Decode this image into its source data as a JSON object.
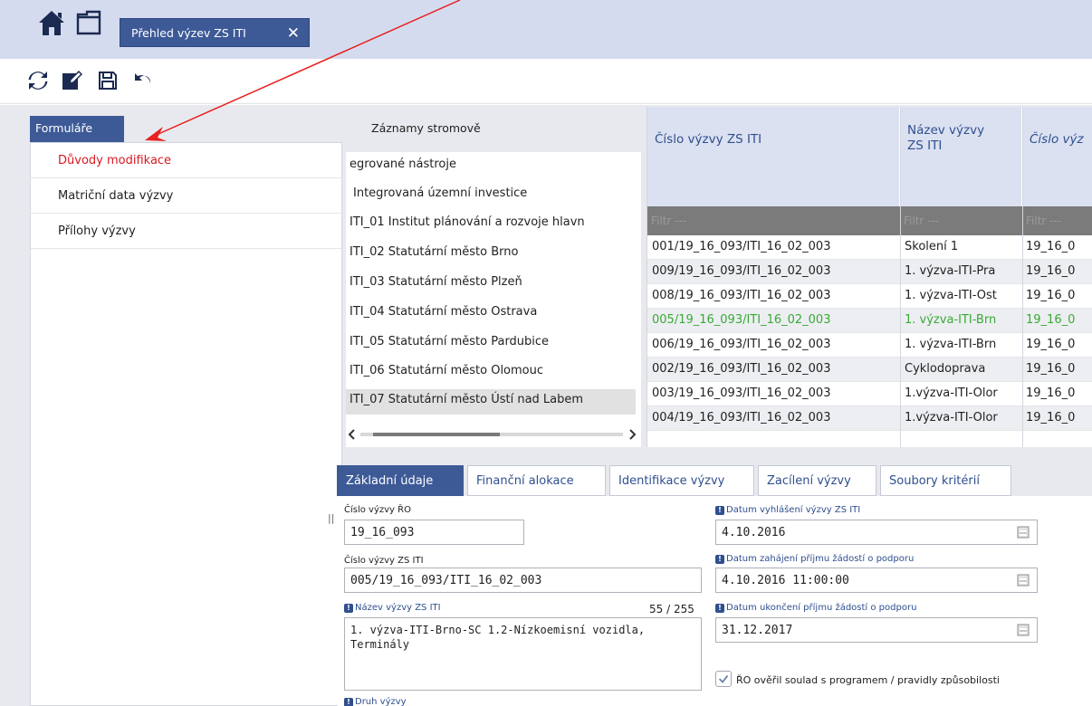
{
  "header": {
    "tab_label": "Přehled výzev ZS ITI",
    "close_glyph": "✕"
  },
  "icons": [
    "home-icon",
    "window-icon",
    "refresh-icon",
    "edit-icon",
    "save-icon",
    "undo-icon",
    "calendar-icon"
  ],
  "forms": {
    "tab_label": "Formuláře",
    "items": [
      {
        "label": "Důvody modifikace"
      },
      {
        "label": "Matriční data výzvy"
      },
      {
        "label": "Přílohy výzvy"
      }
    ]
  },
  "tree": {
    "title": "Záznamy stromově",
    "rows": [
      {
        "label": "egrované nástroje"
      },
      {
        "label": "Integrovaná územní investice"
      },
      {
        "label": "ITI_01 Institut plánování a rozvoje hlavn"
      },
      {
        "label": "ITI_02 Statutární město Brno"
      },
      {
        "label": "ITI_03 Statutární město Plzeň"
      },
      {
        "label": "ITI_04 Statutární město Ostrava"
      },
      {
        "label": "ITI_05 Statutární město Pardubice"
      },
      {
        "label": "ITI_06 Statutární město Olomouc"
      },
      {
        "label": "ITI_07 Statutární město Ústí nad Labem"
      }
    ]
  },
  "grid": {
    "columns": [
      "Číslo výzvy ZS ITI",
      "Název výzvy ZS ITI",
      "Číslo výz"
    ],
    "filter_text": "Filtr ---",
    "rows": [
      {
        "cislo": "001/19_16_093/ITI_16_02_003",
        "nazev": "Školení 1",
        "ro": "19_16_0"
      },
      {
        "cislo": "009/19_16_093/ITI_16_02_003",
        "nazev": "1. výzva-ITI-Pra",
        "ro": "19_16_0"
      },
      {
        "cislo": "008/19_16_093/ITI_16_02_003",
        "nazev": "1. výzva-ITI-Ost",
        "ro": "19_16_0"
      },
      {
        "cislo": "005/19_16_093/ITI_16_02_003",
        "nazev": "1. výzva-ITI-Brn",
        "ro": "19_16_0"
      },
      {
        "cislo": "006/19_16_093/ITI_16_02_003",
        "nazev": "1. výzva-ITI-Brn",
        "ro": "19_16_0"
      },
      {
        "cislo": "002/19_16_093/ITI_16_02_003",
        "nazev": "Cyklodoprava",
        "ro": "19_16_0"
      },
      {
        "cislo": "003/19_16_093/ITI_16_02_003",
        "nazev": "1.výzva-ITI-Olor",
        "ro": "19_16_0"
      },
      {
        "cislo": "004/19_16_093/ITI_16_02_003",
        "nazev": "1.výzva-ITI-Olor",
        "ro": "19_16_0"
      }
    ]
  },
  "detail_tabs": [
    "Základní údaje",
    "Finanční alokace",
    "Identifikace výzvy",
    "Zacílení výzvy",
    "Soubory kritérií"
  ],
  "detail": {
    "cislo_ro_label": "Číslo výzvy ŘO",
    "cislo_ro_value": "19_16_093",
    "cislo_zs_label": "Číslo výzvy ZS ITI",
    "cislo_zs_value": "005/19_16_093/ITI_16_02_003",
    "nazev_label": "Název výzvy ZS ITI",
    "nazev_counter": "55 / 255",
    "nazev_value": "1. výzva-ITI-Brno-SC 1.2-Nízkoemisní vozidla, Terminály",
    "datum_vyhlaseni_label": "Datum vyhlášení výzvy ZS ITI",
    "datum_vyhlaseni_value": "4.10.2016",
    "datum_zahajeni_label": "Datum zahájení příjmu žádostí o podporu",
    "datum_zahajeni_value": "4.10.2016 11:00:00",
    "datum_ukonceni_label": "Datum ukončení příjmu žádostí o podporu",
    "datum_ukonceni_value": "31.12.2017",
    "checkbox_label": "ŘO ověřil soulad s programem / pravidly způsobilosti",
    "checkbox_checked": true,
    "next_label": "Druh výzvy",
    "required_badge": "!"
  },
  "colors": {
    "accent": "#3d5a97",
    "active_red": "#d71920",
    "selected_green": "#3aa935",
    "arrow_red": "#e8201e"
  }
}
